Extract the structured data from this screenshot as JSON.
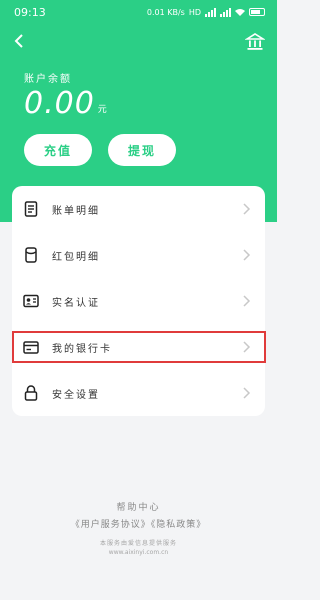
{
  "status_bar": {
    "time": "09:13",
    "network": "0.01 KB/s",
    "hd": "HD"
  },
  "header": {
    "balance_label": "账户余额",
    "balance_value": "0.00",
    "balance_unit": "元"
  },
  "buttons": {
    "recharge": "充值",
    "withdraw": "提现"
  },
  "menu": {
    "items": [
      {
        "label": "账单明细",
        "icon": "document-icon"
      },
      {
        "label": "红包明细",
        "icon": "red-packet-icon"
      },
      {
        "label": "实名认证",
        "icon": "id-card-icon"
      },
      {
        "label": "我的银行卡",
        "icon": "bank-card-icon"
      },
      {
        "label": "安全设置",
        "icon": "lock-icon"
      }
    ]
  },
  "footer": {
    "help": "帮助中心",
    "agreement": "《用户服务协议》",
    "privacy": "《隐私政策》",
    "note": "本服务由爱信息提供服务",
    "domain": "www.aixinyi.com.cn"
  },
  "colors": {
    "brand": "#2bcf86",
    "highlight": "#e03b3b"
  }
}
